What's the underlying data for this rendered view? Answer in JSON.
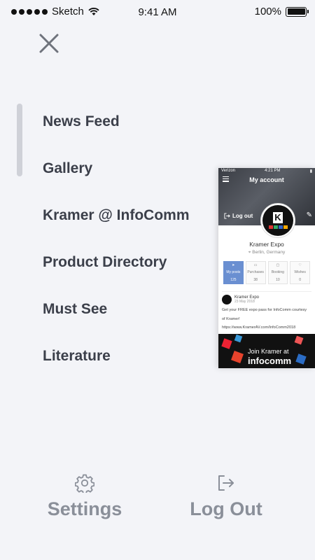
{
  "status_bar": {
    "carrier": "Sketch",
    "time": "9:41 AM",
    "battery": "100%",
    "battery_level": 1.0
  },
  "menu": {
    "items": [
      {
        "label": "News Feed"
      },
      {
        "label": "Gallery"
      },
      {
        "label": "Kramer @ InfoComm"
      },
      {
        "label": "Product Directory"
      },
      {
        "label": "Must See"
      },
      {
        "label": "Literature"
      }
    ]
  },
  "bottom": {
    "settings_label": "Settings",
    "logout_label": "Log Out"
  },
  "preview": {
    "status_carrier": "Verizon",
    "status_time": "4:21 PM",
    "title": "My account",
    "logout_label": "Log out",
    "profile_name": "Kramer Expo",
    "profile_location": "Berlin, Germany",
    "stats": [
      {
        "label": "My posts",
        "value": "125"
      },
      {
        "label": "Purchases",
        "value": "38"
      },
      {
        "label": "Booking",
        "value": "10"
      },
      {
        "label": "Wishes",
        "value": "0"
      }
    ],
    "post": {
      "author": "Kramer Expo",
      "date": "23 May 2018",
      "text_line1": "Get your FREE expo pass for InfoComm courtesy",
      "text_line2": "of Kramer!",
      "text_line3": "https://www.KramerAV.com/InfoComm2018",
      "banner_line1": "Join Kramer at",
      "banner_line2": "infocomm"
    },
    "logo_colors": [
      "#d33",
      "#3a6",
      "#36c",
      "#fa0"
    ]
  },
  "colors": {
    "background": "#f3f4f8",
    "menu_text": "#3b3f4a",
    "bottom_text": "#8a8f99",
    "accent_stat": "#6a8fd1"
  }
}
